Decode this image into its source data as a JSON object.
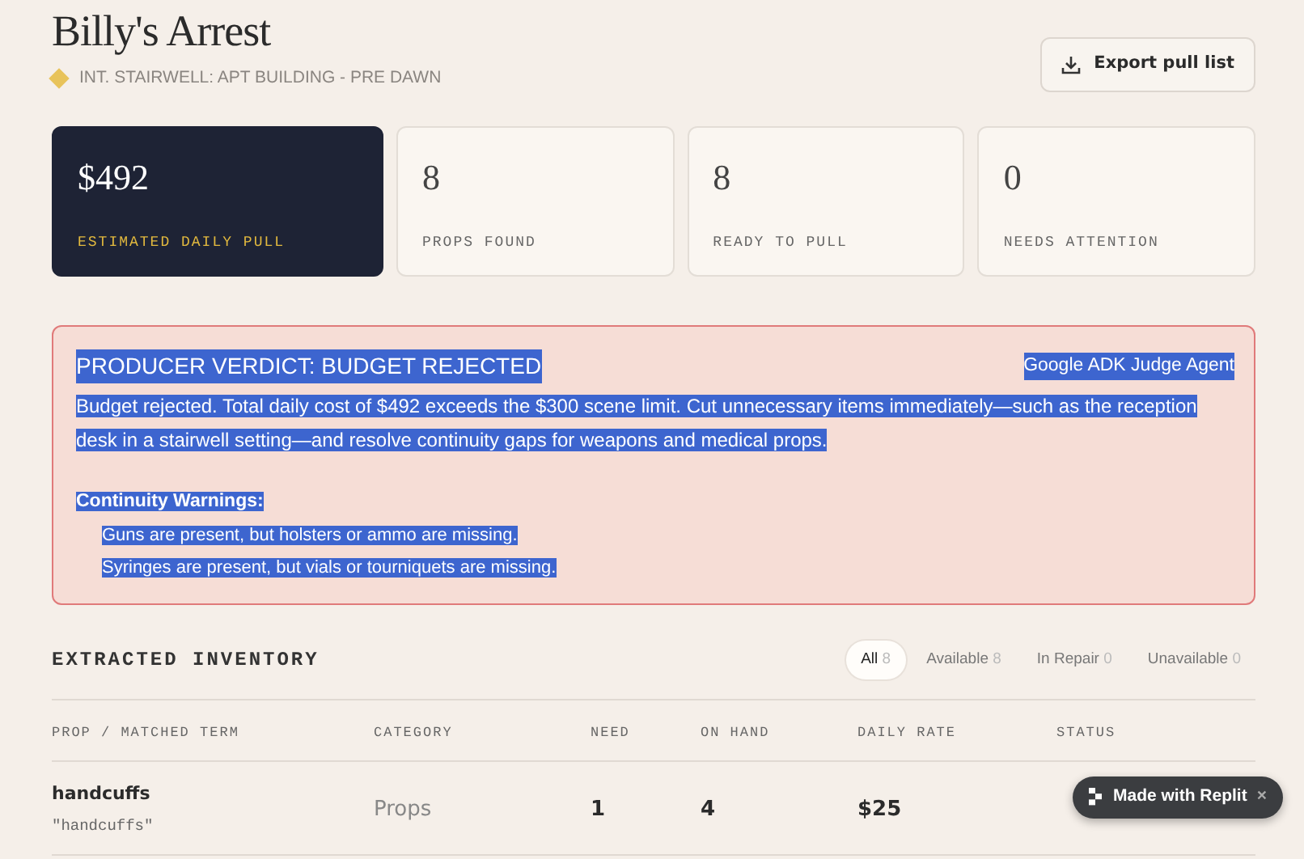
{
  "header": {
    "title": "Billy's Arrest",
    "scene": "INT. STAIRWELL: APT BUILDING - PRE DAWN",
    "export_button": "Export pull list"
  },
  "stats": [
    {
      "value": "$492",
      "label": "ESTIMATED DAILY PULL",
      "kind": "primary"
    },
    {
      "value": "8",
      "label": "PROPS FOUND",
      "kind": "plain"
    },
    {
      "value": "8",
      "label": "READY TO PULL",
      "kind": "plain"
    },
    {
      "value": "0",
      "label": "NEEDS ATTENTION",
      "kind": "plain"
    }
  ],
  "verdict": {
    "title": "PRODUCER VERDICT: BUDGET REJECTED",
    "agent": "Google ADK Judge Agent",
    "text_selected": true,
    "message": "Budget rejected. Total daily cost of $492 exceeds the $300 scene limit. Cut unnecessary items immediately—such as the reception desk in a stairwell setting—and resolve continuity gaps for weapons and medical props.",
    "warnings_title": "Continuity Warnings:",
    "warnings": [
      "Guns are present, but holsters or ammo are missing.",
      "Syringes are present, but vials or tourniquets are missing."
    ]
  },
  "inventory": {
    "title": "EXTRACTED INVENTORY",
    "filters": [
      {
        "label": "All",
        "count": "8",
        "selected": true
      },
      {
        "label": "Available",
        "count": "8",
        "selected": false
      },
      {
        "label": "In Repair",
        "count": "0",
        "selected": false
      },
      {
        "label": "Unavailable",
        "count": "0",
        "selected": false
      }
    ],
    "columns": [
      "PROP / MATCHED TERM",
      "CATEGORY",
      "NEED",
      "ON HAND",
      "DAILY RATE",
      "STATUS"
    ],
    "rows": [
      {
        "prop": "handcuffs",
        "term": "\"handcuffs\"",
        "category": "Props",
        "need": "1",
        "on_hand": "4",
        "daily_rate": "$25"
      }
    ]
  },
  "badge": {
    "label": "Made with Replit",
    "close": "×"
  }
}
